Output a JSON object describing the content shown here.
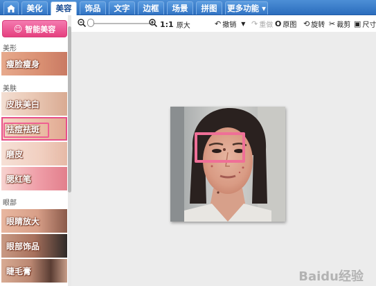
{
  "tabs": [
    {
      "label": "",
      "icon": "home-icon"
    },
    {
      "label": "美化"
    },
    {
      "label": "美容"
    },
    {
      "label": "饰品"
    },
    {
      "label": "文字"
    },
    {
      "label": "边框"
    },
    {
      "label": "场景"
    },
    {
      "label": "拼图"
    },
    {
      "label": "更多功能 ▾"
    }
  ],
  "active_tab": "美容",
  "sidebar": {
    "smart_button": "智能美容",
    "sections": [
      {
        "title": "美形",
        "items": [
          "瘦脸瘦身"
        ]
      },
      {
        "title": "美肤",
        "items": [
          "皮肤美白",
          "祛痘祛斑",
          "磨皮",
          "腮红笔"
        ]
      },
      {
        "title": "眼部",
        "items": [
          "眼睛放大",
          "眼部饰品",
          "睫毛膏"
        ]
      }
    ],
    "selected_item": "祛痘祛斑"
  },
  "toolbar": {
    "ratio": "1:1",
    "fit": "原大",
    "undo": "撤销",
    "redo": "重做",
    "original": "原图",
    "rotate": "旋转",
    "crop": "裁剪",
    "size": "尺寸"
  },
  "watermark": "Baidu经验",
  "colors": {
    "tab_bar": "#3a7fcc",
    "accent_pink": "#e5407f",
    "canvas_bg": "#ececec"
  }
}
